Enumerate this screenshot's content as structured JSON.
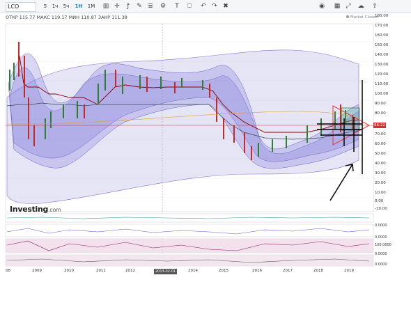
{
  "toolbar": {
    "symbol": "LCO",
    "timeframes": [
      "5",
      "1ч",
      "5ч",
      "1Н",
      "1М"
    ],
    "active_timeframe": "1Н",
    "chart_type_icon": "candlestick-icon",
    "icons": [
      "crosshair-icon",
      "indicators-icon",
      "draw-icon",
      "settings-icon",
      "compare-icon",
      "text-icon",
      "undo-icon",
      "redo-icon",
      "delete-icon",
      "camera-icon",
      "layout-icon",
      "fullscreen-icon",
      "share-icon"
    ]
  },
  "ohlc": {
    "open_label": "ОТКР",
    "open": "115.77",
    "high_label": "МАКС",
    "high": "119.17",
    "low_label": "МИН",
    "low": "110.87",
    "close_label": "ЗАКР",
    "close": "111.38"
  },
  "status": "Market Closed",
  "price_axis": [
    "180.00",
    "170.00",
    "160.00",
    "150.00",
    "140.00",
    "130.00",
    "120.00",
    "110.00",
    "100.00",
    "90.00",
    "80.00",
    "70.00",
    "60.00",
    "50.00",
    "40.00",
    "30.00",
    "20.00",
    "10.00",
    "0.00",
    "-10.00"
  ],
  "last_price": "66.22",
  "year_axis": [
    "08",
    "2009",
    "2010",
    "2011",
    "2012",
    "2013",
    "2014",
    "2015",
    "2016",
    "2017",
    "2018",
    "2019"
  ],
  "crosshair_date": "2013-02-01",
  "logo": {
    "name": "Investing",
    "suffix": ".com"
  },
  "indicators": {
    "ind1_axis": [
      "0.0000"
    ],
    "ind2_axis": [
      "0.0000"
    ],
    "ind3_axis": [
      "100.0000",
      "0.0000"
    ],
    "ind4_axis": [
      "0.0000"
    ]
  },
  "colors": {
    "accent": "#1e7bd9",
    "band": "#6a5acd",
    "bearish": "#c62828",
    "bullish": "#2e7d32",
    "last_price": "#d32f2f"
  }
}
